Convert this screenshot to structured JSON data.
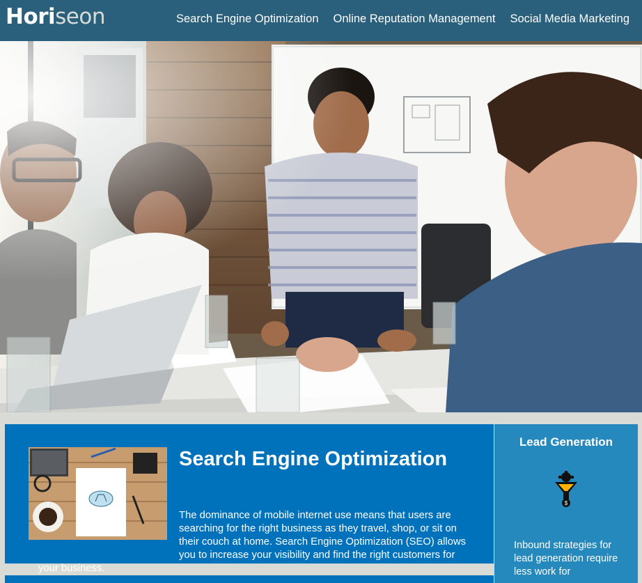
{
  "header": {
    "logo_prefix": "Hori",
    "logo_suffix": "seon",
    "nav": [
      {
        "label": "Search Engine Optimization"
      },
      {
        "label": "Online Reputation Management"
      },
      {
        "label": "Social Media Marketing"
      }
    ]
  },
  "seo": {
    "title": "Search Engine Optimization",
    "text": "The dominance of mobile internet use means that users are searching for the right business as they travel, shop, or sit on their couch at home. Search Engine Optimization (SEO) allows you to increase your visibility and find the right customers for your business."
  },
  "aside": {
    "title": "Lead Generation",
    "icon": "funnel-dollar-icon",
    "text": "Inbound strategies for lead generation require less work for"
  },
  "colors": {
    "header": "#2a607c",
    "card": "#0072bb",
    "aside": "#2589bd",
    "page": "#d9dcd6"
  }
}
